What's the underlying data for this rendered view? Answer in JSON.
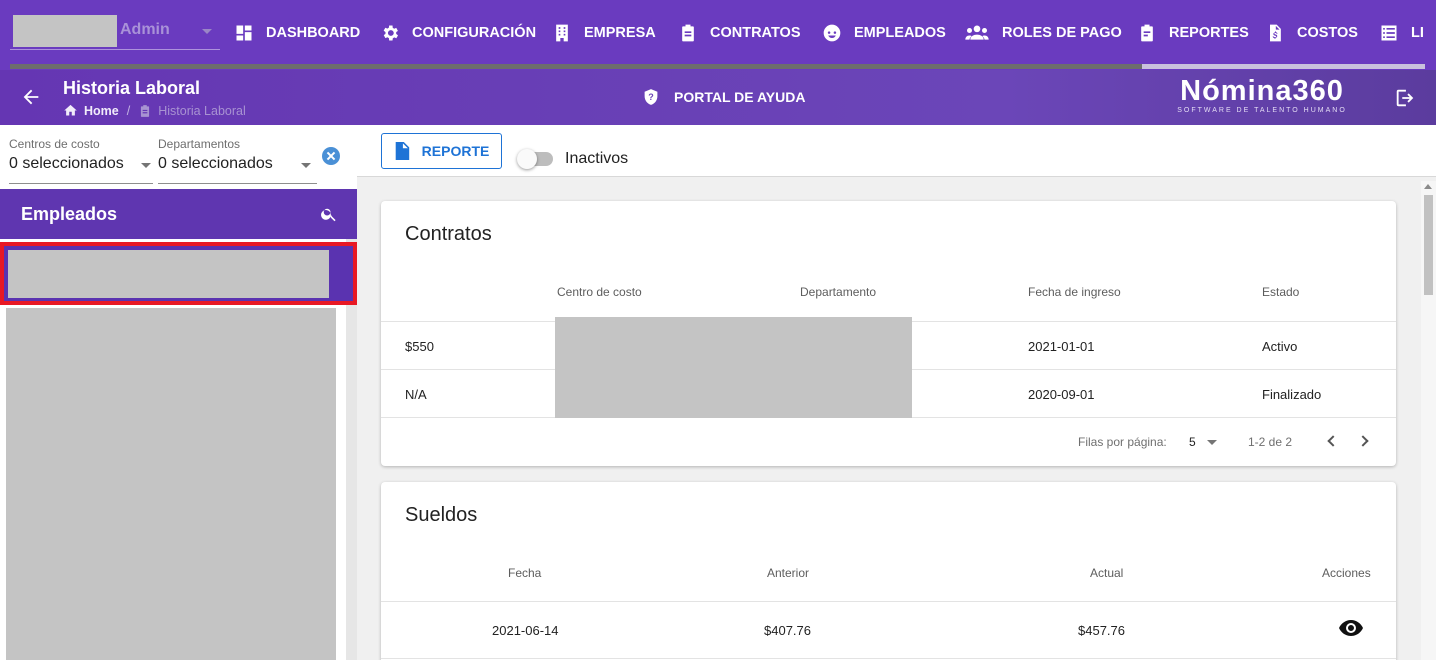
{
  "topnav": {
    "role": "Admin",
    "items": [
      {
        "label": "DASHBOARD",
        "icon": "dashboard-icon"
      },
      {
        "label": "CONFIGURACIÓN",
        "icon": "gear-icon"
      },
      {
        "label": "EMPRESA",
        "icon": "building-icon"
      },
      {
        "label": "CONTRATOS",
        "icon": "clipboard-icon"
      },
      {
        "label": "EMPLEADOS",
        "icon": "face-icon"
      },
      {
        "label": "ROLES DE PAGO",
        "icon": "people-icon"
      },
      {
        "label": "REPORTES",
        "icon": "report-icon"
      },
      {
        "label": "COSTOS",
        "icon": "invoice-icon"
      },
      {
        "label": "LI",
        "icon": "list-icon"
      }
    ],
    "progress": 0.8
  },
  "header": {
    "title": "Historia Laboral",
    "breadcrumb_home": "Home",
    "breadcrumb_current": "Historia Laboral",
    "help_label": "PORTAL DE AYUDA",
    "brand_name": "Nómina360",
    "brand_tagline": "SOFTWARE DE TALENTO HUMANO"
  },
  "filters": {
    "cost_center_label": "Centros de costo",
    "cost_center_value": "0 seleccionados",
    "department_label": "Departamentos",
    "department_value": "0 seleccionados"
  },
  "employees": {
    "title": "Empleados"
  },
  "toolbar": {
    "report_label": "REPORTE",
    "inactive_label": "Inactivos",
    "inactive_on": false
  },
  "contracts": {
    "title": "Contratos",
    "headers": [
      "Centro de costo",
      "Departamento",
      "Fecha de ingreso",
      "Estado"
    ],
    "rows": [
      {
        "salary": "$550",
        "start_date": "2021-01-01",
        "status": "Activo"
      },
      {
        "salary": "N/A",
        "start_date": "2020-09-01",
        "status": "Finalizado"
      }
    ],
    "rows_per_page_label": "Filas por página:",
    "rows_per_page": "5",
    "range": "1-2 de 2"
  },
  "salaries": {
    "title": "Sueldos",
    "headers": [
      "Fecha",
      "Anterior",
      "Actual",
      "Acciones"
    ],
    "rows": [
      {
        "date": "2021-06-14",
        "previous": "$407.76",
        "current": "$457.76"
      }
    ]
  },
  "colors": {
    "primary": "#6a3bbf",
    "accent_blue": "#1e73d6",
    "highlight_red": "#e81824"
  }
}
